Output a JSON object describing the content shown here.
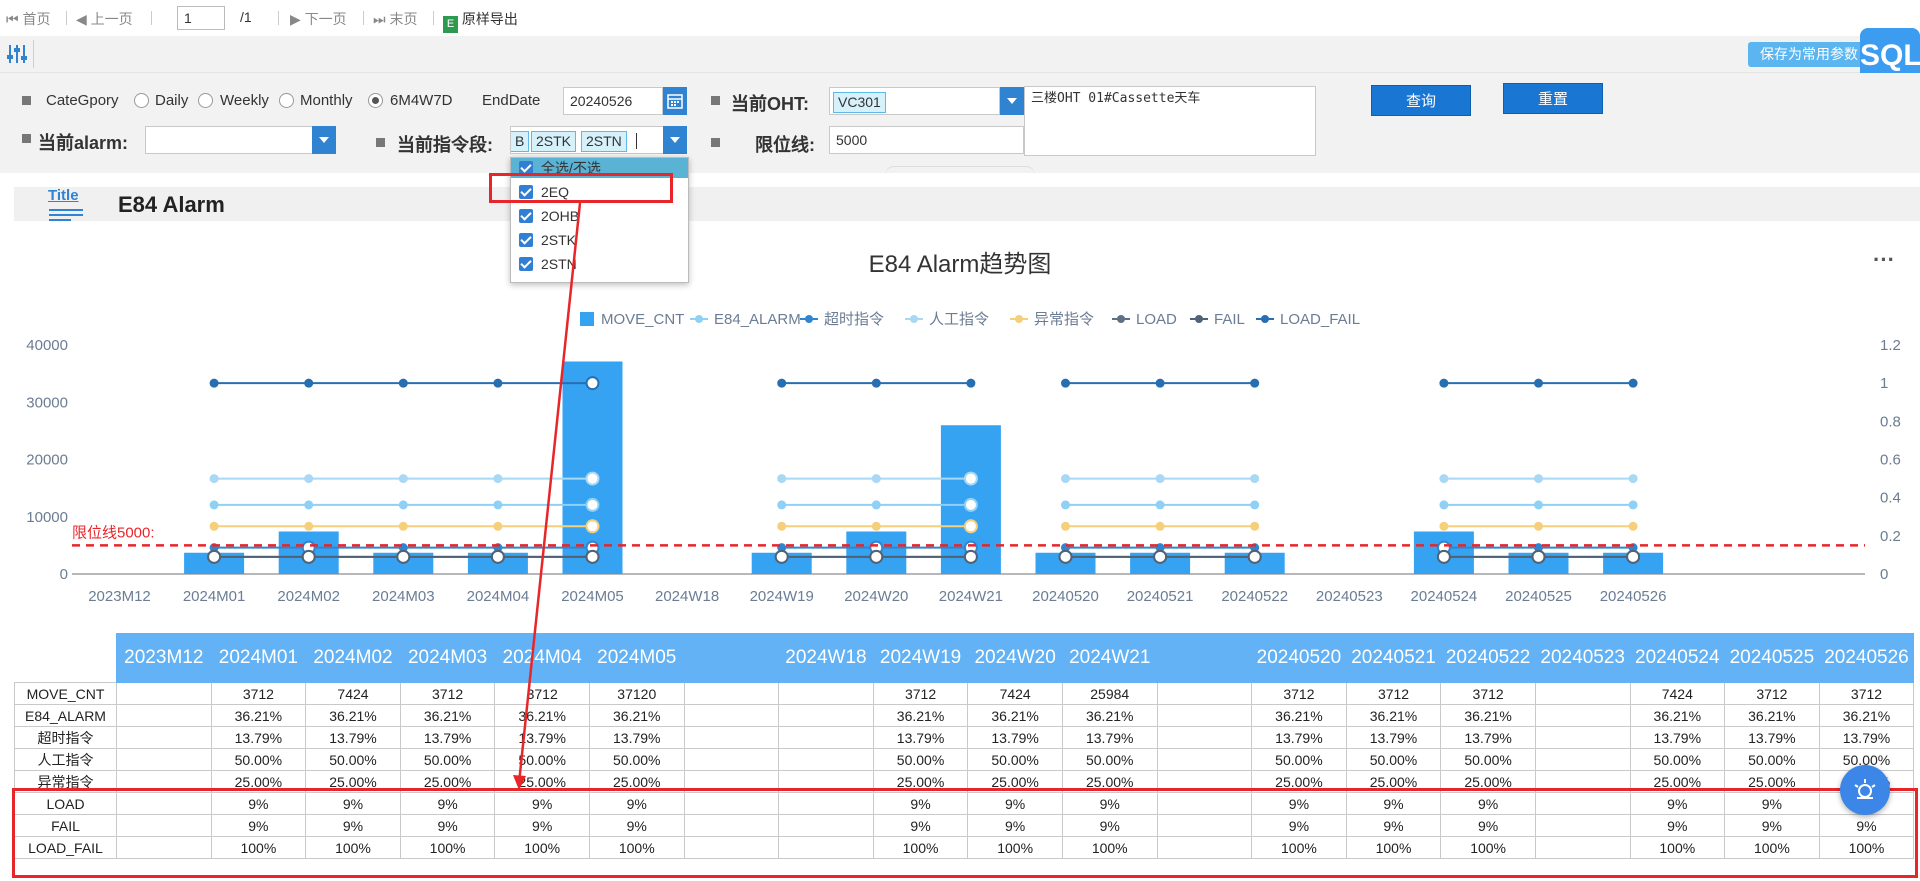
{
  "toolbar": {
    "first": "首页",
    "prev": "上一页",
    "page_value": "1",
    "page_total": "/1",
    "next": "下一页",
    "last": "末页",
    "export": "原样导出"
  },
  "top": {
    "save_common": "保存为常用参数",
    "sql_badge": "SQL"
  },
  "params": {
    "category_label": "CateGpory",
    "options": [
      "Daily",
      "Weekly",
      "Monthly",
      "6M4W7D"
    ],
    "selected_option": "6M4W7D",
    "enddate_label": "EndDate",
    "enddate_value": "20240526",
    "oht_label": "当前OHT:",
    "oht_tag": "VC301",
    "oht_desc": "三楼OHT 01#Cassette天车",
    "query_btn": "查询",
    "reset_btn": "重置",
    "alarm_label": "当前alarm:",
    "alarm_value": "",
    "segment_label": "当前指令段:",
    "segment_tags": [
      "B",
      "2STK",
      "2STN"
    ],
    "limit_label": "限位线:",
    "limit_value": "5000"
  },
  "dropdown": {
    "select_all": "全选/不选",
    "items": [
      "2EQ",
      "2OHB",
      "2STK",
      "2STN"
    ]
  },
  "report": {
    "title_icon": "Title",
    "title": "E84 Alarm"
  },
  "colors": {
    "accent": "#1976d2",
    "highlight_box": "#e8262a",
    "header_bg": "#62b2f5"
  },
  "chart_data": {
    "type": "bar",
    "title": "E84 Alarm趋势图",
    "categories": [
      "2023M12",
      "2024M01",
      "2024M02",
      "2024M03",
      "2024M04",
      "2024M05",
      "2024W18",
      "2024W19",
      "2024W20",
      "2024W21",
      "20240520",
      "20240521",
      "20240522",
      "20240523",
      "20240524",
      "20240525",
      "20240526"
    ],
    "bar_series": {
      "name": "MOVE_CNT",
      "color": "#35a3f2",
      "values": [
        null,
        3712,
        7424,
        3712,
        3712,
        37120,
        null,
        3712,
        7424,
        25984,
        3712,
        3712,
        3712,
        null,
        7424,
        3712,
        3712
      ]
    },
    "line_series": [
      {
        "name": "E84_ALARM",
        "color": "#8fd0f6",
        "values": [
          null,
          0.3621,
          0.3621,
          0.3621,
          0.3621,
          0.3621,
          null,
          0.3621,
          0.3621,
          0.3621,
          0.3621,
          0.3621,
          0.3621,
          null,
          0.3621,
          0.3621,
          0.3621
        ]
      },
      {
        "name": "超时指令",
        "color": "#2f86d0",
        "values": [
          null,
          0.1379,
          0.1379,
          0.1379,
          0.1379,
          0.1379,
          null,
          0.1379,
          0.1379,
          0.1379,
          0.1379,
          0.1379,
          0.1379,
          null,
          0.1379,
          0.1379,
          0.1379
        ]
      },
      {
        "name": "人工指令",
        "color": "#a8d8f3",
        "values": [
          null,
          0.5,
          0.5,
          0.5,
          0.5,
          0.5,
          null,
          0.5,
          0.5,
          0.5,
          0.5,
          0.5,
          0.5,
          null,
          0.5,
          0.5,
          0.5
        ]
      },
      {
        "name": "异常指令",
        "color": "#f6cf7a",
        "values": [
          null,
          0.25,
          0.25,
          0.25,
          0.25,
          0.25,
          null,
          0.25,
          0.25,
          0.25,
          0.25,
          0.25,
          0.25,
          null,
          0.25,
          0.25,
          0.25
        ]
      },
      {
        "name": "LOAD",
        "color": "#5d7184",
        "values": [
          null,
          0.09,
          0.09,
          0.09,
          0.09,
          0.09,
          null,
          0.09,
          0.09,
          0.09,
          0.09,
          0.09,
          0.09,
          null,
          0.09,
          0.09,
          0.09
        ]
      },
      {
        "name": "FAIL",
        "color": "#4f6276",
        "values": [
          null,
          0.09,
          0.09,
          0.09,
          0.09,
          0.09,
          null,
          0.09,
          0.09,
          0.09,
          0.09,
          0.09,
          0.09,
          null,
          0.09,
          0.09,
          0.09
        ]
      },
      {
        "name": "LOAD_FAIL",
        "color": "#276fb0",
        "values": [
          null,
          1,
          1,
          1,
          1,
          1,
          null,
          1,
          1,
          1,
          1,
          1,
          1,
          null,
          1,
          1,
          1
        ]
      }
    ],
    "groups": [
      [
        1,
        5
      ],
      [
        7,
        9
      ],
      [
        10,
        12
      ],
      [
        14,
        16
      ]
    ],
    "y_left": {
      "ticks": [
        "0",
        "10000",
        "20000",
        "30000",
        "40000"
      ],
      "range": [
        0,
        40000
      ]
    },
    "y_right": {
      "ticks": [
        "0",
        "0.2",
        "0.4",
        "0.6",
        "0.8",
        "1",
        "1.2"
      ],
      "range": [
        0,
        1.2
      ]
    },
    "limit_line": {
      "label": "限位线5000:",
      "value": 5000,
      "color": "#e8262a"
    },
    "legend_position": "top-center",
    "more_icon": "···"
  },
  "table": {
    "headers": [
      "2023M12",
      "2024M01",
      "2024M02",
      "2024M03",
      "2024M04",
      "2024M05",
      "",
      "2024W18",
      "2024W19",
      "2024W20",
      "2024W21",
      "",
      "20240520",
      "20240521",
      "20240522",
      "20240523",
      "20240524",
      "20240525",
      "20240526"
    ],
    "rows": [
      {
        "label": "MOVE_CNT",
        "cells": [
          "",
          "3712",
          "7424",
          "3712",
          "3712",
          "37120",
          "",
          "",
          "3712",
          "7424",
          "25984",
          "",
          "3712",
          "3712",
          "3712",
          "",
          "7424",
          "3712",
          "3712"
        ]
      },
      {
        "label": "E84_ALARM",
        "cells": [
          "",
          "36.21%",
          "36.21%",
          "36.21%",
          "36.21%",
          "36.21%",
          "",
          "",
          "36.21%",
          "36.21%",
          "36.21%",
          "",
          "36.21%",
          "36.21%",
          "36.21%",
          "",
          "36.21%",
          "36.21%",
          "36.21%"
        ]
      },
      {
        "label": "超时指令",
        "cells": [
          "",
          "13.79%",
          "13.79%",
          "13.79%",
          "13.79%",
          "13.79%",
          "",
          "",
          "13.79%",
          "13.79%",
          "13.79%",
          "",
          "13.79%",
          "13.79%",
          "13.79%",
          "",
          "13.79%",
          "13.79%",
          "13.79%"
        ]
      },
      {
        "label": "人工指令",
        "cells": [
          "",
          "50.00%",
          "50.00%",
          "50.00%",
          "50.00%",
          "50.00%",
          "",
          "",
          "50.00%",
          "50.00%",
          "50.00%",
          "",
          "50.00%",
          "50.00%",
          "50.00%",
          "",
          "50.00%",
          "50.00%",
          "50.00%"
        ]
      },
      {
        "label": "异常指令",
        "cells": [
          "",
          "25.00%",
          "25.00%",
          "25.00%",
          "25.00%",
          "25.00%",
          "",
          "",
          "25.00%",
          "25.00%",
          "25.00%",
          "",
          "25.00%",
          "25.00%",
          "25.00%",
          "",
          "25.00%",
          "25.00%",
          "25.00%"
        ]
      },
      {
        "label": "LOAD",
        "cells": [
          "",
          "9%",
          "9%",
          "9%",
          "9%",
          "9%",
          "",
          "",
          "9%",
          "9%",
          "9%",
          "",
          "9%",
          "9%",
          "9%",
          "",
          "9%",
          "9%",
          "9%"
        ]
      },
      {
        "label": "FAIL",
        "cells": [
          "",
          "9%",
          "9%",
          "9%",
          "9%",
          "9%",
          "",
          "",
          "9%",
          "9%",
          "9%",
          "",
          "9%",
          "9%",
          "9%",
          "",
          "9%",
          "9%",
          "9%"
        ]
      },
      {
        "label": "LOAD_FAIL",
        "cells": [
          "",
          "100%",
          "100%",
          "100%",
          "100%",
          "100%",
          "",
          "",
          "100%",
          "100%",
          "100%",
          "",
          "100%",
          "100%",
          "100%",
          "",
          "100%",
          "100%",
          "100%"
        ]
      }
    ]
  }
}
